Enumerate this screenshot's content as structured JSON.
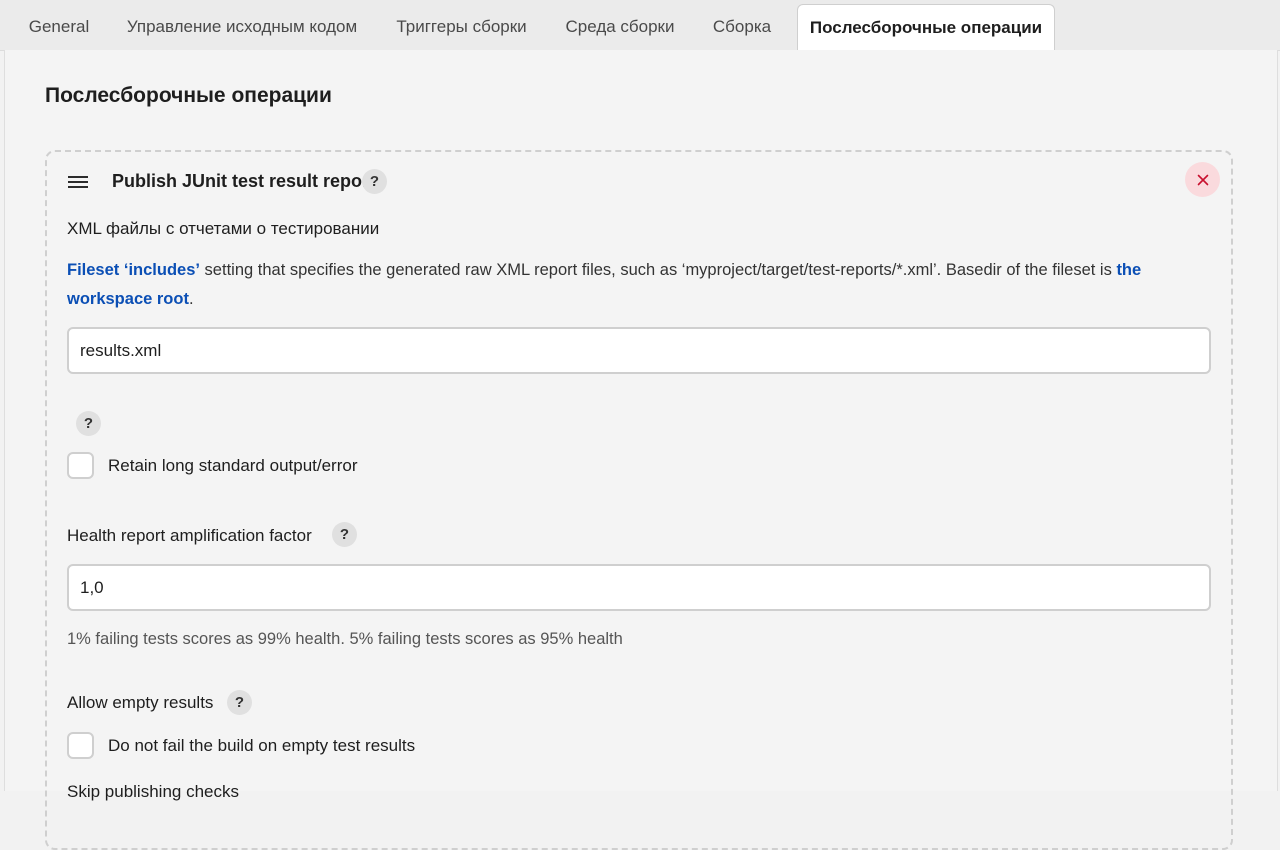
{
  "tabs": [
    {
      "label": "General"
    },
    {
      "label": "Управление исходным кодом"
    },
    {
      "label": "Триггеры сборки"
    },
    {
      "label": "Среда сборки"
    },
    {
      "label": "Сборка"
    },
    {
      "label": "Послесборочные операции"
    }
  ],
  "active_tab_index": 5,
  "section": {
    "title": "Послесборочные операции"
  },
  "step": {
    "title": "Publish JUnit test result report",
    "help_symbol": "?",
    "xml_files": {
      "label": "XML файлы с отчетами о тестировании",
      "desc_link1": "Fileset ‘includes’",
      "desc_text1": " setting that specifies the generated raw XML report files, such as ‘myproject/target/test-reports/*.xml’. Basedir of the fileset is ",
      "desc_link2": "the workspace root",
      "desc_text2": ".",
      "value": "results.xml"
    },
    "retain_output": {
      "label": "Retain long standard output/error",
      "checked": false
    },
    "health_factor": {
      "label": "Health report amplification factor",
      "value": "1,0",
      "hint": "1% failing tests scores as 99% health. 5% failing tests scores as 95% health"
    },
    "allow_empty": {
      "label": "Allow empty results",
      "checkbox_label": "Do not fail the build on empty test results",
      "checked": false
    },
    "skip_publishing_label": "Skip publishing checks"
  },
  "colors": {
    "link": "#0b4fb5",
    "close_bg": "#fadadd",
    "close_icon": "#c8102e"
  },
  "icons": [
    "drag-handle-icon",
    "help-icon",
    "close-icon"
  ]
}
